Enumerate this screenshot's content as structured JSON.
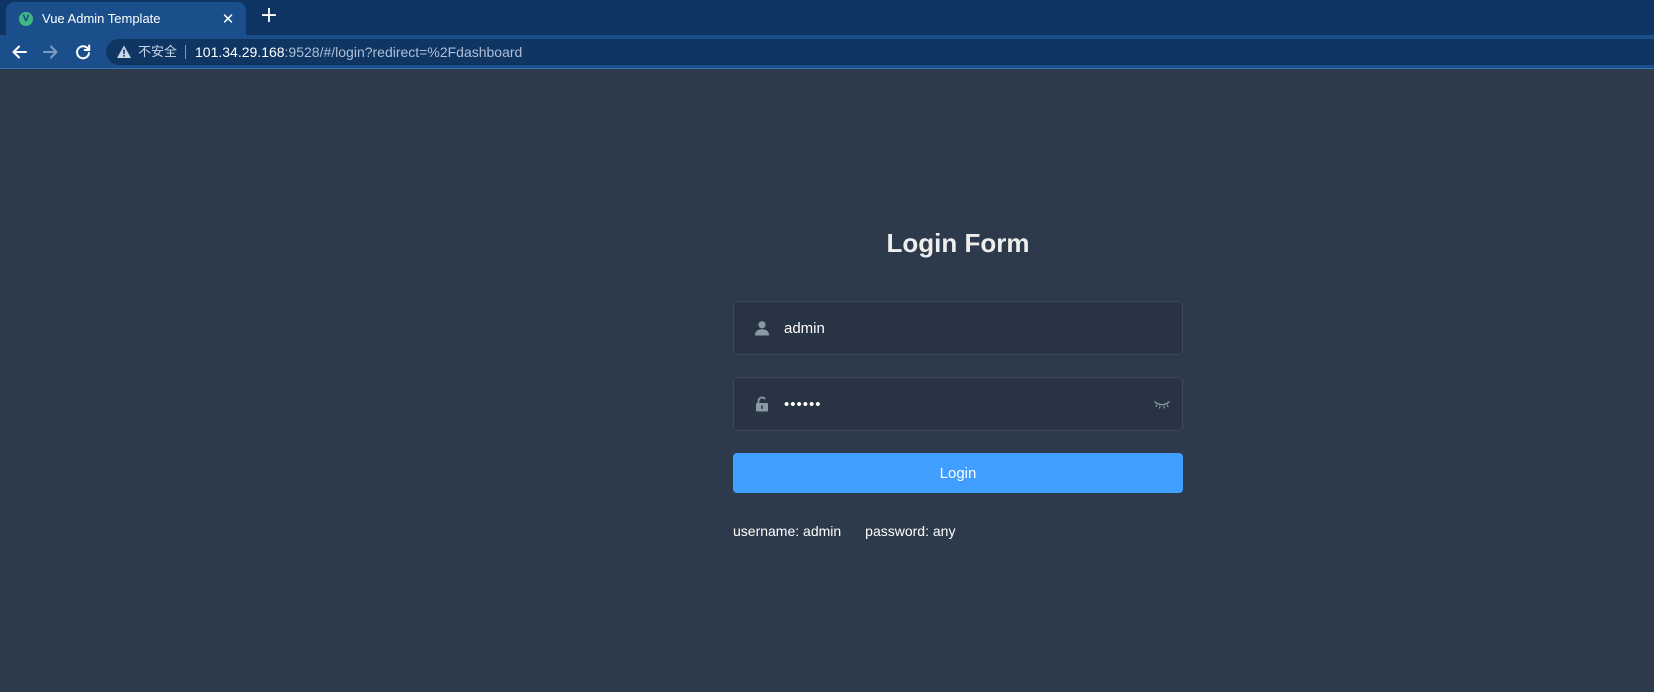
{
  "browser": {
    "tab": {
      "title": "Vue Admin Template",
      "favicon_letter": "V",
      "close_glyph": "✕",
      "favicon_color": "#41b883"
    },
    "new_tab_glyph": "+",
    "address_bar": {
      "security_label": "不安全",
      "url_host": "101.34.29.168",
      "url_rest": ":9528/#/login?redirect=%2Fdashboard"
    },
    "nav_icons": [
      "back-arrow-icon",
      "forward-arrow-icon",
      "reload-icon",
      "warning-icon"
    ]
  },
  "login": {
    "title": "Login Form",
    "username": {
      "value": "admin",
      "icon": "user-icon"
    },
    "password": {
      "value": "••••••",
      "icon": "lock-icon",
      "toggle_icon": "eye-closed-icon"
    },
    "button_label": "Login",
    "tips": {
      "username": "username: admin",
      "password": "password: any"
    }
  },
  "colors": {
    "page_background": "#2d3a4b",
    "primary_button": "#409eff",
    "chrome_tabbar": "#0d3463",
    "chrome_toolbar": "#1b4f8c"
  }
}
